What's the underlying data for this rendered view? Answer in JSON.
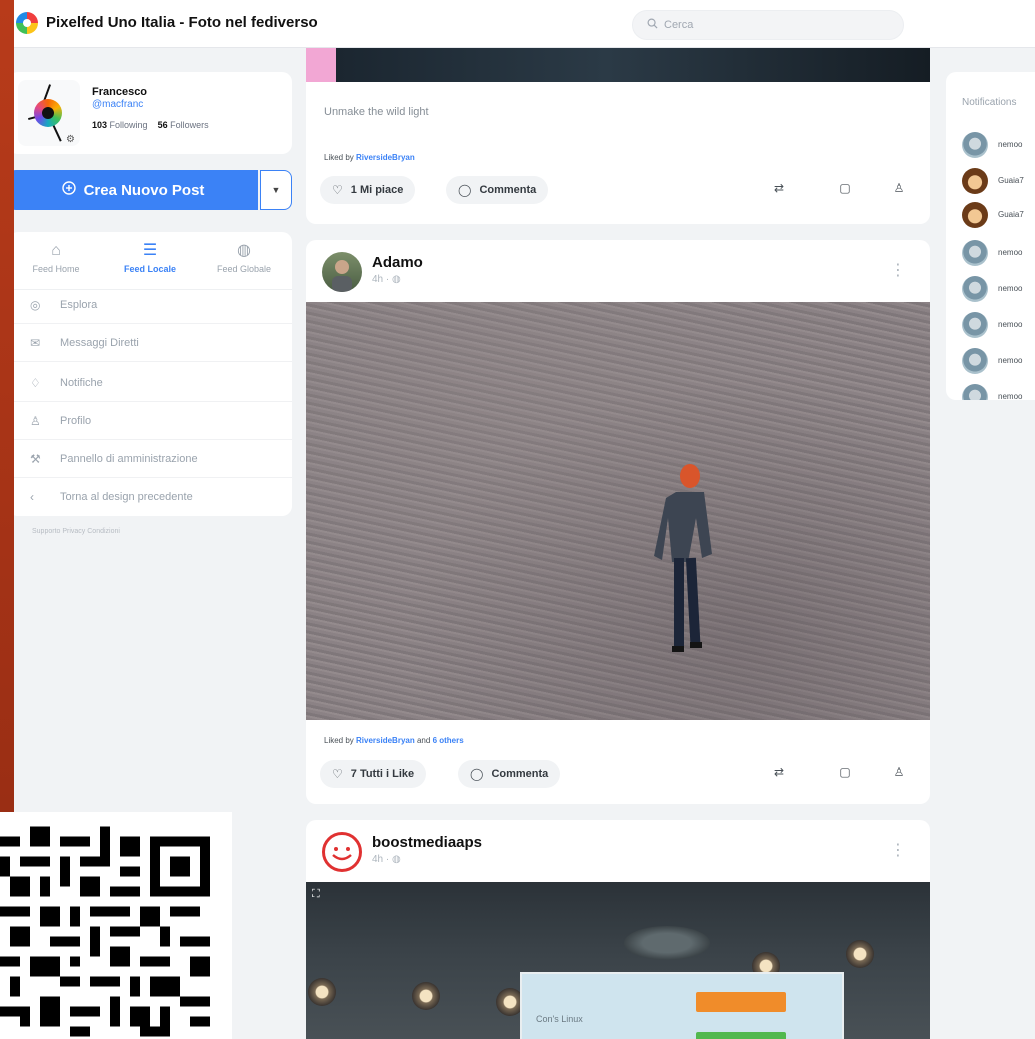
{
  "app": {
    "title": "Pixelfed Uno Italia - Foto nel fediverso"
  },
  "search": {
    "placeholder": "Cerca"
  },
  "profile": {
    "name": "Francesco",
    "handle": "@macfranc",
    "following_count": "103",
    "following_label": "Following",
    "followers_count": "56",
    "followers_label": "Followers"
  },
  "compose": {
    "label": "Crea Nuovo Post",
    "icon": "plus-circle-icon",
    "dropdown_icon": "caret-down-icon"
  },
  "feed_tabs": [
    {
      "label": "Feed Home",
      "icon": "home-icon",
      "active": false
    },
    {
      "label": "Feed Locale",
      "icon": "list-icon",
      "active": true
    },
    {
      "label": "Feed Globale",
      "icon": "globe-icon",
      "active": false
    }
  ],
  "nav": [
    {
      "label": "Esplora",
      "icon": "explore-icon"
    },
    {
      "label": "Messaggi Diretti",
      "icon": "message-icon"
    },
    {
      "label": "Notifiche",
      "icon": "bell-icon"
    },
    {
      "label": "Profilo",
      "icon": "user-icon"
    },
    {
      "label": "Pannello di amministrazione",
      "icon": "admin-icon"
    },
    {
      "label": "Torna al design precedente",
      "icon": "chevron-left-icon"
    }
  ],
  "footer": {
    "text": "Supporto  Privacy  Condizioni"
  },
  "posts": [
    {
      "caption": "Unmake the wild light",
      "liked_prefix": "Liked by",
      "liked_user": "RiversideBryan",
      "like_label": "1 Mi piace",
      "comment_label": "Commenta"
    },
    {
      "author": "Adamo",
      "time": "4h",
      "liked_prefix": "Liked by",
      "liked_user": "RiversideBryan",
      "liked_and": "and",
      "liked_others": "6 others",
      "like_label": "7 Tutti i Like",
      "comment_label": "Commenta"
    },
    {
      "author": "boostmediaaps",
      "time": "4h",
      "screen_text": "Con's Linux"
    }
  ],
  "notifications": {
    "title": "Notifications",
    "items": [
      {
        "name": "nemoo",
        "avatar": "cat"
      },
      {
        "name": "Guaia7",
        "avatar": "dog"
      },
      {
        "name": "Guaia7",
        "avatar": "dog"
      },
      {
        "name": "nemoo",
        "avatar": "cat"
      },
      {
        "name": "nemoo",
        "avatar": "cat"
      },
      {
        "name": "nemoo",
        "avatar": "cat"
      },
      {
        "name": "nemoo",
        "avatar": "cat"
      },
      {
        "name": "nemoo",
        "avatar": "cat"
      }
    ]
  },
  "colors": {
    "accent": "#3b82f6",
    "slide_frame": "#b33a1c"
  }
}
